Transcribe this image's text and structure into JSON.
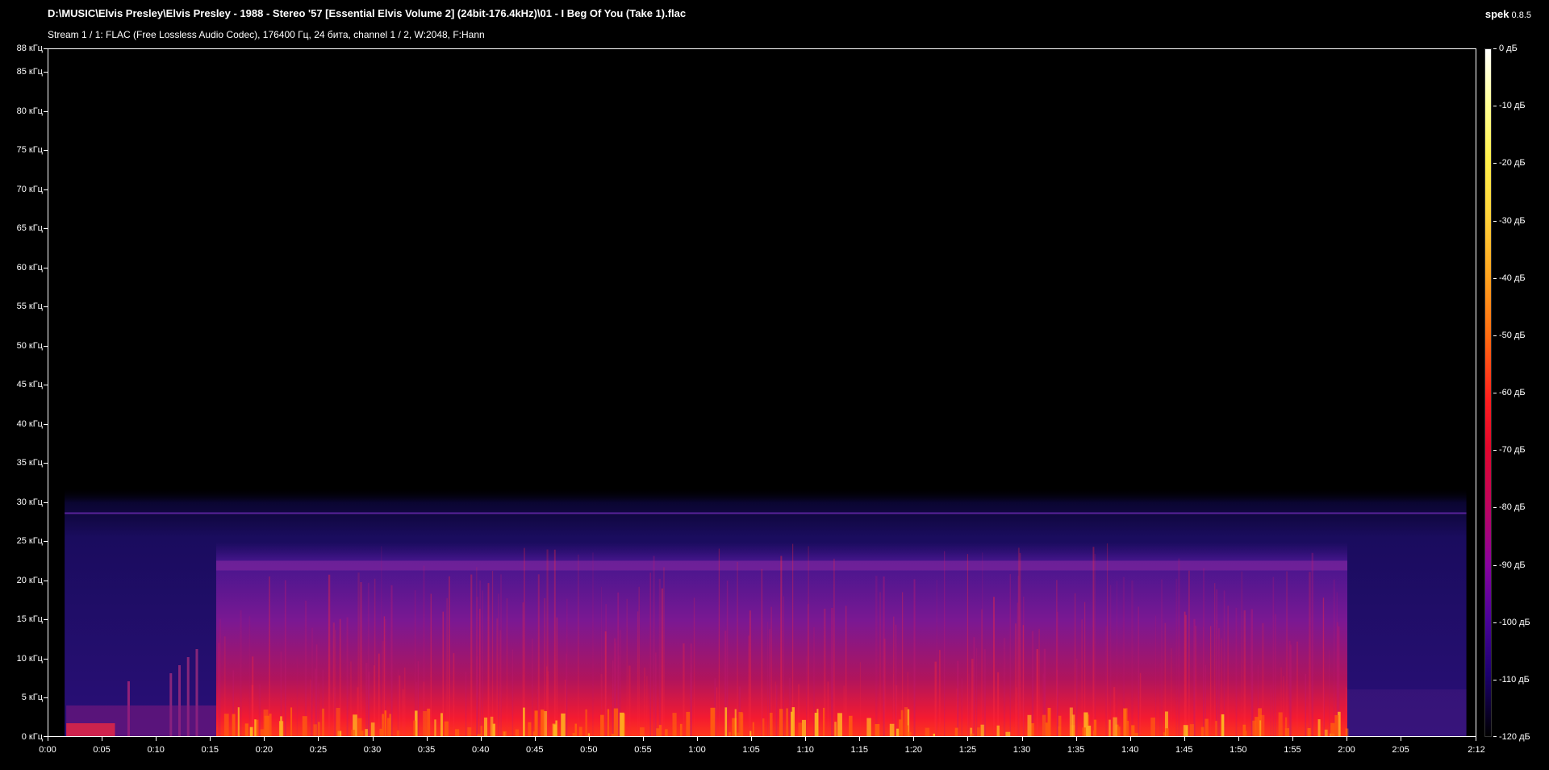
{
  "app": {
    "name": "spek",
    "version": "0.8.5"
  },
  "file_title": "D:\\MUSIC\\Elvis Presley\\Elvis Presley - 1988 - Stereo '57 [Essential Elvis Volume 2] (24bit-176.4kHz)\\01 - I Beg Of You (Take 1).flac",
  "stream_info": "Stream 1 / 1: FLAC (Free Lossless Audio Codec), 176400 Гц, 24 бита, channel 1 / 2, W:2048, F:Hann",
  "colors": {
    "background": "#000000",
    "axis": "#ffffff",
    "noise_floor": "#1a0b5c",
    "signal_mid": "#7a1a9a",
    "signal_high": "#ff1b2c",
    "peak": "#ffb020"
  },
  "chart_data": {
    "type": "heatmap",
    "title": "",
    "xlabel": "",
    "ylabel": "",
    "x_tick_labels": [
      "0:00",
      "0:05",
      "0:10",
      "0:15",
      "0:20",
      "0:25",
      "0:30",
      "0:35",
      "0:40",
      "0:45",
      "0:50",
      "0:55",
      "1:00",
      "1:05",
      "1:10",
      "1:15",
      "1:20",
      "1:25",
      "1:30",
      "1:35",
      "1:40",
      "1:45",
      "1:50",
      "1:55",
      "2:00",
      "2:05",
      "2:12"
    ],
    "x_tick_seconds": [
      0,
      5,
      10,
      15,
      20,
      25,
      30,
      35,
      40,
      45,
      50,
      55,
      60,
      65,
      70,
      75,
      80,
      85,
      90,
      95,
      100,
      105,
      110,
      115,
      120,
      125,
      132
    ],
    "xlim_seconds": [
      0,
      132
    ],
    "y_tick_labels": [
      "0 кГц",
      "5 кГц",
      "10 кГц",
      "15 кГц",
      "20 кГц",
      "25 кГц",
      "30 кГц",
      "35 кГц",
      "40 кГц",
      "45 кГц",
      "50 кГц",
      "55 кГц",
      "60 кГц",
      "65 кГц",
      "70 кГц",
      "75 кГц",
      "80 кГц",
      "85 кГц",
      "88 кГц"
    ],
    "y_tick_khz": [
      0,
      5,
      10,
      15,
      20,
      25,
      30,
      35,
      40,
      45,
      50,
      55,
      60,
      65,
      70,
      75,
      80,
      85,
      88
    ],
    "ylim_khz": [
      0,
      88
    ],
    "colorbar_tick_labels": [
      "0 дБ",
      "-10 дБ",
      "-20 дБ",
      "-30 дБ",
      "-40 дБ",
      "-50 дБ",
      "-60 дБ",
      "-70 дБ",
      "-80 дБ",
      "-90 дБ",
      "-100 дБ",
      "-110 дБ",
      "-120 дБ"
    ],
    "colorbar_db": [
      0,
      -10,
      -20,
      -30,
      -40,
      -50,
      -60,
      -70,
      -80,
      -90,
      -100,
      -110,
      -120
    ],
    "signal_start_seconds": 1.5,
    "signal_end_seconds": 131,
    "noise_ceiling_khz": 32,
    "hum_line_khz": 28.7,
    "music_start_seconds": 15.5,
    "music_end_seconds": 120,
    "music_band_khz": 22,
    "music_ceiling_khz": 25
  }
}
